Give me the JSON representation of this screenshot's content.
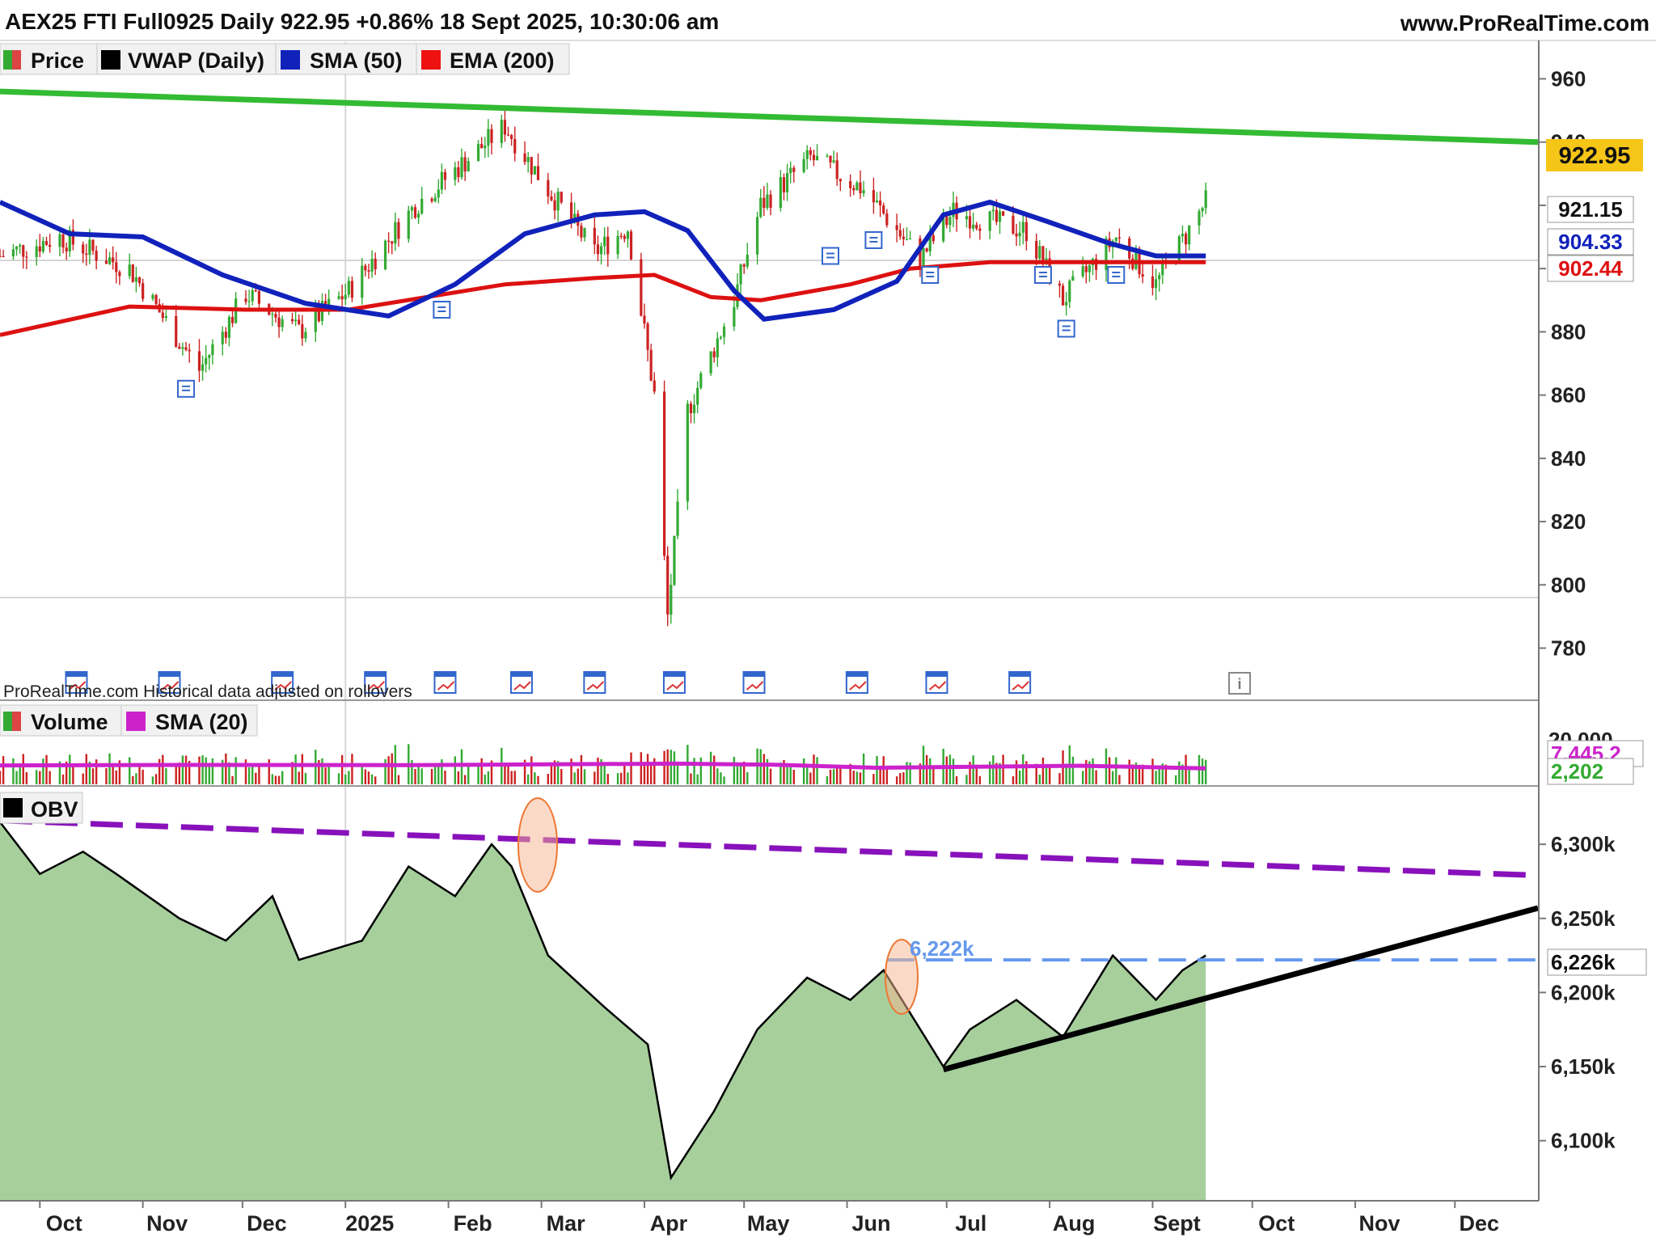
{
  "header": {
    "title": "AEX25 FTI Full0925 Daily 922.95 +0.86% 18 Sept 2025, 10:30:06 am",
    "site": "www.ProRealTime.com"
  },
  "colors": {
    "up": "#33aa33",
    "down": "#cc2222",
    "vwap": "#000000",
    "sma50": "#1122bb",
    "ema200": "#dd1111",
    "trend_green": "#33bb33",
    "vol_sma": "#cc22cc",
    "obv_fill": "#a6cf9c",
    "obv_line": "#000000",
    "resist": "#8811bb",
    "support": "#000000",
    "level": "#6699ee",
    "highlight": "#ee8844",
    "last_price_bg": "#f5c518"
  },
  "watermark": "ProRealTime.com  Historical data adjusted on rollovers",
  "panels": {
    "price": {
      "legend": [
        {
          "label": "Price",
          "icon": "price-updown-icon"
        },
        {
          "label": "VWAP (Daily)",
          "icon": "vwap-swatch-icon"
        },
        {
          "label": "SMA (50)",
          "icon": "sma-swatch-icon"
        },
        {
          "label": "EMA (200)",
          "icon": "ema-swatch-icon"
        }
      ],
      "badges": {
        "last": "922.95",
        "prev": "921.15",
        "sma": "904.33",
        "ema": "902.44"
      }
    },
    "volume": {
      "legend": [
        {
          "label": "Volume",
          "icon": "volume-updown-icon"
        },
        {
          "label": "SMA (20)",
          "icon": "vol-sma-swatch-icon"
        }
      ],
      "badges": {
        "sma": "7,445.2",
        "last": "2,202"
      },
      "ticks": [
        "20,000"
      ]
    },
    "obv": {
      "legend": [
        {
          "label": "OBV",
          "icon": "obv-swatch-icon"
        }
      ],
      "badges": {
        "last": "6,226k"
      },
      "level_label": "6,222k"
    }
  },
  "chart_data": [
    {
      "type": "line",
      "panel": "price",
      "title": "AEX25 FTI Full0925 Daily",
      "yticks": [
        960,
        940,
        920,
        900,
        880,
        860,
        840,
        820,
        800,
        780
      ],
      "ylim": [
        774,
        966
      ],
      "x_labels": [
        "Oct",
        "Nov",
        "Dec",
        "2025",
        "Feb",
        "Mar",
        "Apr",
        "May",
        "Jun",
        "Jul",
        "Aug",
        "Sept",
        "Oct",
        "Nov",
        "Dec"
      ],
      "x_range": [
        "2024-09-19",
        "2025-12-26"
      ],
      "grid": "horizontal lines at 900 and 800; vertical line at 2025",
      "series": [
        {
          "name": "Price (close)",
          "x": [
            "2024-09-19",
            "2024-10-07",
            "2024-10-28",
            "2024-11-18",
            "2024-12-02",
            "2024-12-18",
            "2025-01-02",
            "2025-01-22",
            "2025-02-18",
            "2025-03-03",
            "2025-03-17",
            "2025-03-27",
            "2025-04-04",
            "2025-04-08",
            "2025-04-14",
            "2025-04-28",
            "2025-05-06",
            "2025-05-21",
            "2025-06-06",
            "2025-06-23",
            "2025-07-03",
            "2025-07-25",
            "2025-08-05",
            "2025-08-21",
            "2025-09-02",
            "2025-09-17"
          ],
          "values": [
            904,
            910,
            900,
            868,
            892,
            880,
            893,
            920,
            945,
            925,
            905,
            913,
            860,
            790,
            855,
            890,
            920,
            935,
            925,
            903,
            918,
            912,
            890,
            910,
            895,
            921
          ]
        },
        {
          "name": "SMA (50)",
          "x": [
            "2024-09-19",
            "2024-10-10",
            "2024-11-01",
            "2024-11-25",
            "2024-12-20",
            "2025-01-14",
            "2025-02-03",
            "2025-02-24",
            "2025-03-17",
            "2025-04-01",
            "2025-04-14",
            "2025-04-28",
            "2025-05-07",
            "2025-05-28",
            "2025-06-16",
            "2025-06-30",
            "2025-07-14",
            "2025-07-31",
            "2025-08-19",
            "2025-09-02",
            "2025-09-17"
          ],
          "values": [
            921,
            911,
            910,
            898,
            889,
            885,
            895,
            911,
            917,
            918,
            912,
            893,
            884,
            887,
            896,
            917,
            921,
            915,
            908,
            904,
            904
          ]
        },
        {
          "name": "EMA (200)",
          "x": [
            "2024-09-19",
            "2024-10-28",
            "2024-12-02",
            "2025-01-02",
            "2025-02-18",
            "2025-03-17",
            "2025-04-04",
            "2025-04-21",
            "2025-05-06",
            "2025-06-02",
            "2025-06-20",
            "2025-07-14",
            "2025-08-11",
            "2025-09-17"
          ],
          "values": [
            879,
            888,
            887,
            887,
            895,
            897,
            898,
            891,
            890,
            895,
            900,
            902,
            902,
            902
          ]
        },
        {
          "name": "Trendline",
          "x": [
            "2024-09-19",
            "2025-12-26"
          ],
          "values": [
            956,
            940
          ]
        }
      ]
    },
    {
      "type": "bar",
      "panel": "volume",
      "title": "Volume",
      "ylim": [
        0,
        20000
      ],
      "series": [
        {
          "name": "SMA (20)",
          "x": [
            "2024-09-19",
            "2024-11-15",
            "2025-01-20",
            "2025-04-10",
            "2025-05-10",
            "2025-06-10",
            "2025-08-10",
            "2025-09-17"
          ],
          "values": [
            7300,
            7500,
            7400,
            8000,
            7600,
            6400,
            7200,
            6200
          ]
        }
      ],
      "last": 2202
    },
    {
      "type": "area",
      "panel": "obv",
      "title": "OBV",
      "yticks": [
        "6,300k",
        "6,250k",
        "6,200k",
        "6,150k",
        "6,100k"
      ],
      "ylim": [
        6060,
        6335
      ],
      "series": [
        {
          "name": "OBV",
          "x": [
            "2024-09-19",
            "2024-10-01",
            "2024-10-14",
            "2024-10-24",
            "2024-11-12",
            "2024-11-26",
            "2024-12-10",
            "2024-12-18",
            "2025-01-06",
            "2025-01-20",
            "2025-02-03",
            "2025-02-14",
            "2025-02-20",
            "2025-03-03",
            "2025-03-20",
            "2025-04-02",
            "2025-04-09",
            "2025-04-22",
            "2025-05-05",
            "2025-05-20",
            "2025-06-02",
            "2025-06-12",
            "2025-06-30",
            "2025-07-08",
            "2025-07-22",
            "2025-08-05",
            "2025-08-20",
            "2025-09-02",
            "2025-09-10",
            "2025-09-17"
          ],
          "values": [
            6315,
            6280,
            6295,
            6280,
            6250,
            6235,
            6265,
            6222,
            6235,
            6285,
            6265,
            6300,
            6285,
            6225,
            6190,
            6165,
            6075,
            6120,
            6175,
            6210,
            6195,
            6215,
            6150,
            6175,
            6195,
            6170,
            6225,
            6195,
            6215,
            6225
          ]
        },
        {
          "name": "Resistance",
          "x": [
            "2024-09-19",
            "2025-12-26"
          ],
          "values": [
            6316,
            6279
          ]
        },
        {
          "name": "Support",
          "x": [
            "2025-06-30",
            "2025-12-26"
          ],
          "values": [
            6148,
            6257
          ]
        },
        {
          "name": "6,222k level",
          "x": [
            "2025-06-13",
            "2025-12-26"
          ],
          "values": [
            6222,
            6222
          ]
        }
      ]
    }
  ]
}
